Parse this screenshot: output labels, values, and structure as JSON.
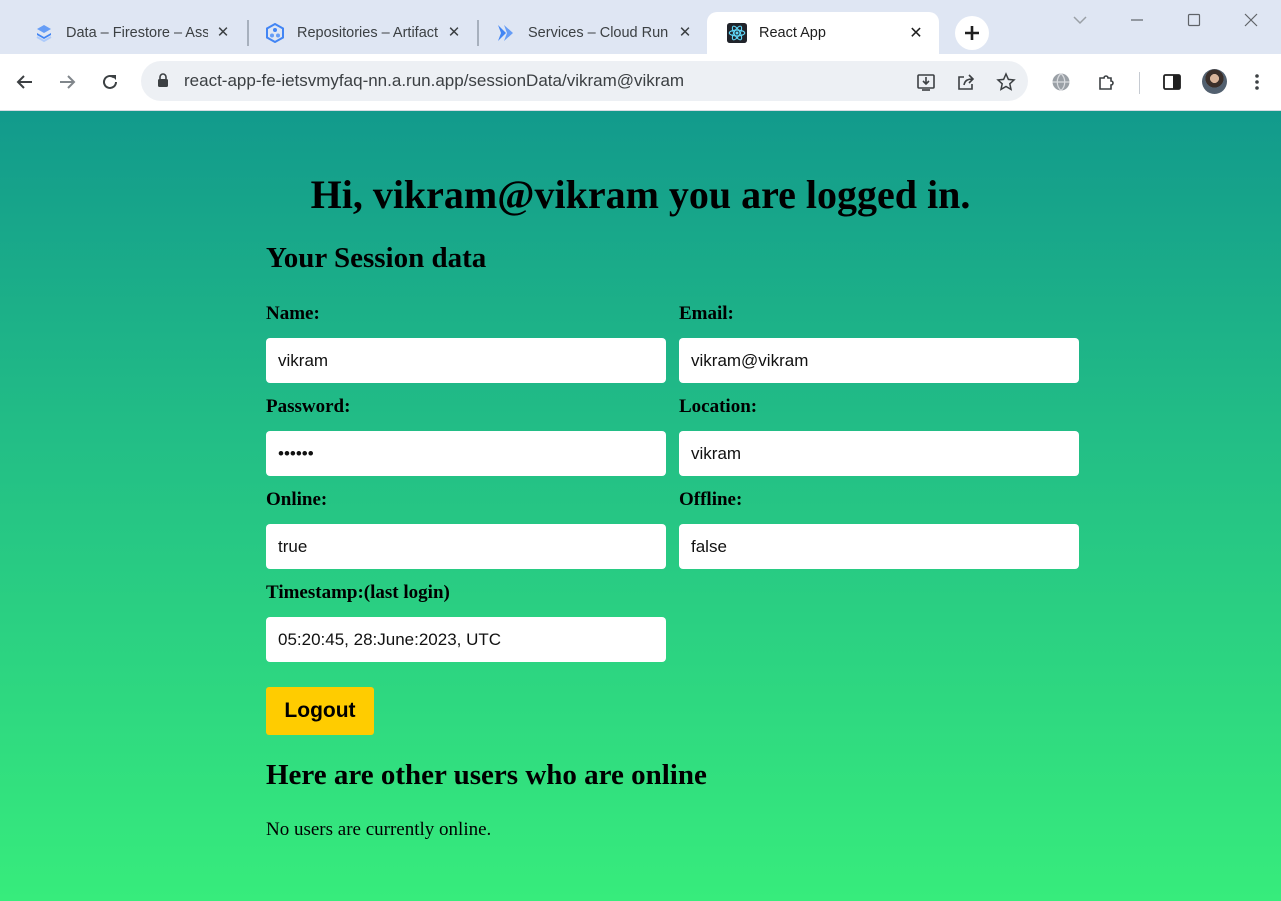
{
  "browser": {
    "tabs": [
      {
        "title": "Data – Firestore – Assets",
        "icon": "firestore-icon",
        "active": false
      },
      {
        "title": "Repositories – Artifact Registry",
        "icon": "artifact-registry-icon",
        "active": false
      },
      {
        "title": "Services – Cloud Run",
        "icon": "cloud-run-icon",
        "active": false
      },
      {
        "title": "React App",
        "icon": "react-icon",
        "active": true
      }
    ],
    "url": "react-app-fe-ietsvmyfaq-nn.a.run.app/sessionData/vikram@vikram",
    "accent_color": "#1a73e8"
  },
  "page": {
    "title": "Hi, vikram@vikram you are logged in.",
    "session_heading": "Your Session data",
    "fields": {
      "name": {
        "label": "Name:",
        "value": "vikram"
      },
      "email": {
        "label": "Email:",
        "value": "vikram@vikram"
      },
      "password": {
        "label": "Password:",
        "value": "vikram"
      },
      "location": {
        "label": "Location:",
        "value": "vikram"
      },
      "online": {
        "label": "Online:",
        "value": "true"
      },
      "offline": {
        "label": "Offline:",
        "value": "false"
      },
      "timestamp": {
        "label": "Timestamp:(last login)",
        "value": "05:20:45, 28:June:2023, UTC"
      }
    },
    "logout_label": "Logout",
    "logout_color": "#ffcc00",
    "online_heading": "Here are other users who are online",
    "online_empty_text": "No users are currently online.",
    "background_top": "#129a8c",
    "background_bottom": "#37ec7c"
  }
}
